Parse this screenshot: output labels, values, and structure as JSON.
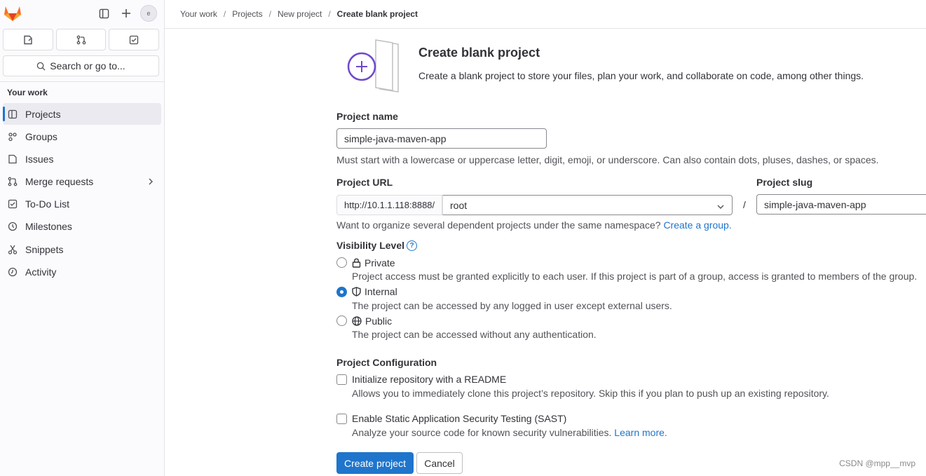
{
  "sidebar": {
    "avatar_alt": "e",
    "search_label": "Search or go to...",
    "section_title": "Your work",
    "items": [
      {
        "label": "Projects",
        "icon": "project-icon"
      },
      {
        "label": "Groups",
        "icon": "group-icon"
      },
      {
        "label": "Issues",
        "icon": "issues-icon"
      },
      {
        "label": "Merge requests",
        "icon": "merge-request-icon"
      },
      {
        "label": "To-Do List",
        "icon": "todo-icon"
      },
      {
        "label": "Milestones",
        "icon": "milestone-icon"
      },
      {
        "label": "Snippets",
        "icon": "snippet-icon"
      },
      {
        "label": "Activity",
        "icon": "history-icon"
      }
    ]
  },
  "breadcrumb": [
    "Your work",
    "Projects",
    "New project",
    "Create blank project"
  ],
  "header": {
    "title": "Create blank project",
    "description": "Create a blank project to store your files, plan your work, and collaborate on code, among other things."
  },
  "form": {
    "project_name_label": "Project name",
    "project_name_value": "simple-java-maven-app",
    "project_name_help": "Must start with a lowercase or uppercase letter, digit, emoji, or underscore. Can also contain dots, pluses, dashes, or spaces.",
    "project_url_label": "Project URL",
    "url_prefix": "http://10.1.1.118:8888/",
    "namespace_value": "root",
    "slash": "/",
    "project_slug_label": "Project slug",
    "project_slug_value": "simple-java-maven-app",
    "namespace_help": "Want to organize several dependent projects under the same namespace?",
    "create_group_link": "Create a group.",
    "visibility_label": "Visibility Level",
    "visibility_options": [
      {
        "label": "Private",
        "desc": "Project access must be granted explicitly to each user. If this project is part of a group, access is granted to members of the group.",
        "checked": false
      },
      {
        "label": "Internal",
        "desc": "The project can be accessed by any logged in user except external users.",
        "checked": true
      },
      {
        "label": "Public",
        "desc": "The project can be accessed without any authentication.",
        "checked": false
      }
    ],
    "config_label": "Project Configuration",
    "readme_label": "Initialize repository with a README",
    "readme_desc": "Allows you to immediately clone this project’s repository. Skip this if you plan to push up an existing repository.",
    "sast_label": "Enable Static Application Security Testing (SAST)",
    "sast_desc": "Analyze your source code for known security vulnerabilities.",
    "learn_more_link": "Learn more.",
    "create_button": "Create project",
    "cancel_button": "Cancel"
  },
  "watermark": "CSDN @mpp__mvp",
  "colors": {
    "accent": "#1f75cb",
    "logo": "#e24329"
  }
}
